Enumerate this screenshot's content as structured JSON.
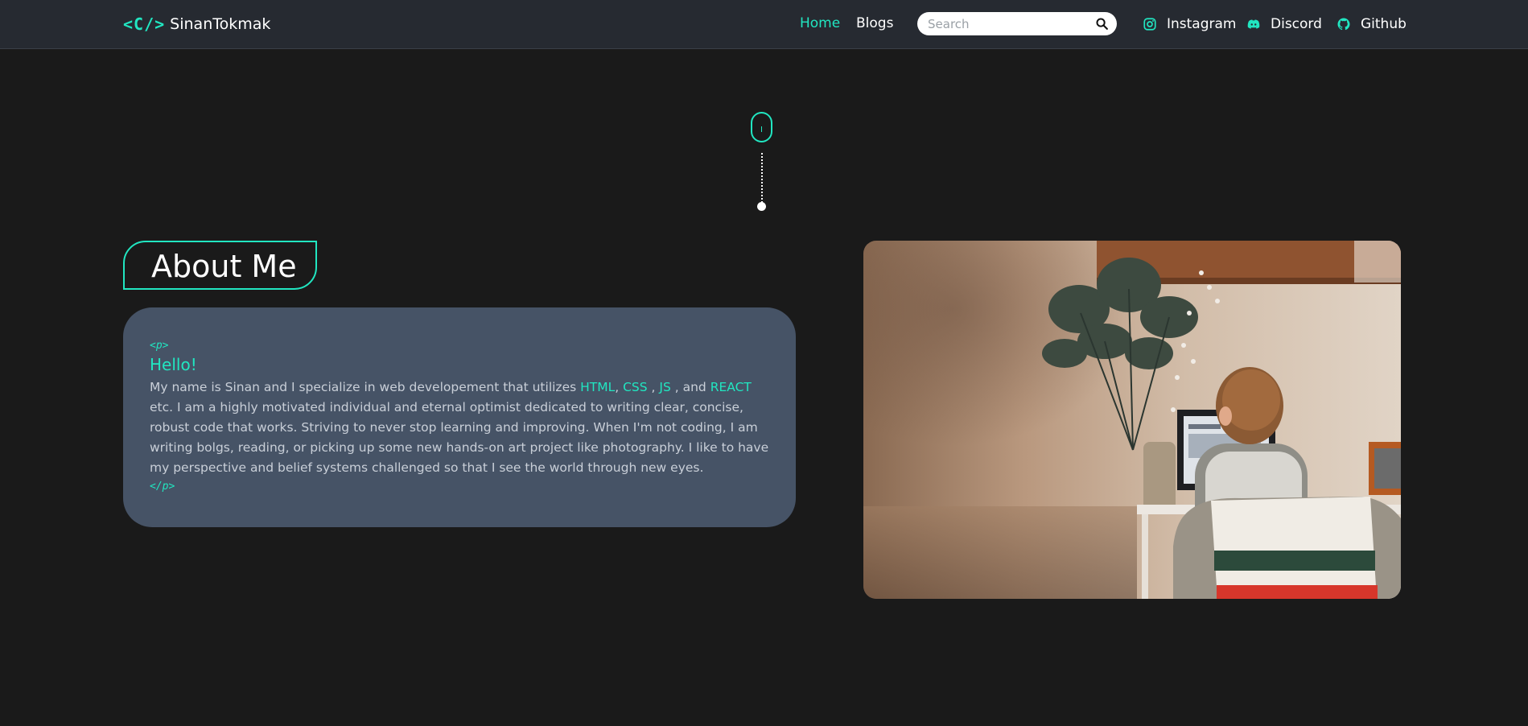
{
  "brand": {
    "logo_mark": "<C/>",
    "name": "SinanTokmak"
  },
  "nav": {
    "links": [
      {
        "label": "Home",
        "active": true
      },
      {
        "label": "Blogs",
        "active": false
      }
    ],
    "search": {
      "placeholder": "Search",
      "value": ""
    },
    "social": [
      {
        "label": "Instagram",
        "icon": "instagram-icon"
      },
      {
        "label": "Discord",
        "icon": "discord-icon"
      },
      {
        "label": "Github",
        "icon": "github-icon"
      }
    ]
  },
  "about": {
    "title": "About Me",
    "open_tag": "<p>",
    "greeting": "Hello!",
    "text_1": "My name is Sinan and I specialize in web developement that utilizes ",
    "tech": [
      "HTML",
      "CSS",
      "JS",
      "REACT"
    ],
    "sep_1": ", ",
    "sep_2": " , ",
    "sep_3": " , and ",
    "text_2": " etc. I am a highly motivated individual and eternal optimist dedicated to writing clear, concise, robust code that works. Striving to never stop learning and improving. When I'm not coding, I am writing bolgs, reading, or picking up some new hands-on art project like photography. I like to have my perspective and belief systems challenged so that I see the world through new eyes.",
    "close_tag": "</p>"
  },
  "colors": {
    "accent": "#21e6c1",
    "navbar_bg": "#262a31",
    "page_bg": "#1a1a1a",
    "card_bg": "#465366"
  }
}
